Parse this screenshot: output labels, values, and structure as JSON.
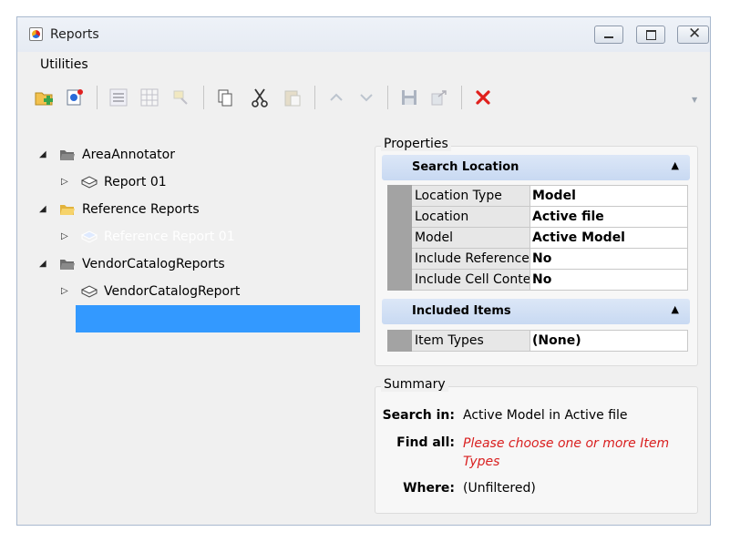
{
  "window": {
    "title": "Reports"
  },
  "menu": {
    "items": [
      "Utilities"
    ]
  },
  "toolbar": {
    "buttons": [
      {
        "icon": "add-folder-icon",
        "enabled": true
      },
      {
        "icon": "new-report-icon",
        "enabled": true
      },
      {
        "icon": "list-view-icon",
        "enabled": false
      },
      {
        "icon": "grid-view-icon",
        "enabled": false
      },
      {
        "icon": "highlight-icon",
        "enabled": false
      },
      {
        "icon": "copy-icon",
        "enabled": true
      },
      {
        "icon": "cut-icon",
        "enabled": true
      },
      {
        "icon": "paste-icon",
        "enabled": false
      },
      {
        "icon": "move-up-icon",
        "enabled": false
      },
      {
        "icon": "move-down-icon",
        "enabled": false
      },
      {
        "icon": "save-icon",
        "enabled": false
      },
      {
        "icon": "export-icon",
        "enabled": false
      },
      {
        "icon": "delete-icon",
        "enabled": true
      }
    ],
    "delete_color": "#e0201c"
  },
  "tree": {
    "nodes": [
      {
        "label": "AreaAnnotator",
        "children": [
          {
            "label": "Report 01"
          }
        ]
      },
      {
        "label": "Reference Reports",
        "children": [
          {
            "label": "Reference Report 01",
            "selected": true
          }
        ]
      },
      {
        "label": "VendorCatalogReports",
        "children": [
          {
            "label": "VendorCatalogReport"
          }
        ]
      }
    ],
    "selection_color": "#3399ff"
  },
  "properties": {
    "label": "Properties",
    "search_location": {
      "title": "Search Location",
      "rows": [
        {
          "key": "Location Type",
          "value": "Model"
        },
        {
          "key": "Location",
          "value": "Active file"
        },
        {
          "key": "Model",
          "value": "Active Model"
        },
        {
          "key": "Include Reference",
          "value": "No"
        },
        {
          "key": "Include Cell Conte",
          "value": "No"
        }
      ]
    },
    "included_items": {
      "title": "Included Items",
      "rows": [
        {
          "key": "Item Types",
          "value": "(None)"
        }
      ]
    }
  },
  "summary": {
    "label": "Summary",
    "search_in": {
      "label": "Search in:",
      "value": "Active Model  in Active file"
    },
    "find_all": {
      "label": "Find all:",
      "line1": "Please choose one or more Item",
      "line2": "Types"
    },
    "where": {
      "label": "Where:",
      "value": "(Unfiltered)"
    },
    "warning_color": "#d92020"
  }
}
